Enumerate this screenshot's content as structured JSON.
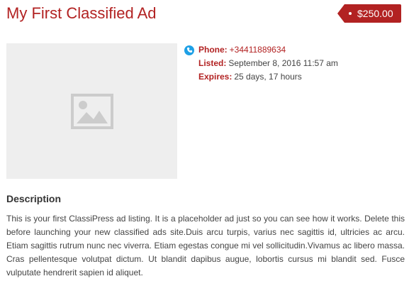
{
  "ad": {
    "title": "My First Classified Ad",
    "price": "$250.00",
    "image_icon": "image-placeholder-icon"
  },
  "meta": {
    "phone_label": "Phone:",
    "phone_value": "+34411889634",
    "listed_label": "Listed:",
    "listed_value": "September 8, 2016 11:57 am",
    "expires_label": "Expires:",
    "expires_value": "25 days, 17 hours"
  },
  "description": {
    "heading": "Description",
    "body": "This is your first ClassiPress ad listing. It is a placeholder ad just so you can see how it works. Delete this before launching your new classified ads site.Duis arcu turpis, varius nec sagittis id, ultricies ac arcu. Etiam sagittis rutrum nunc nec viverra. Etiam egestas congue mi vel sollicitudin.Vivamus ac libero massa. Cras pellentesque volutpat dictum. Ut blandit dapibus augue, lobortis cursus mi blandit sed. Fusce vulputate hendrerit sapien id aliquet."
  },
  "colors": {
    "accent": "#b22222",
    "phone_icon": "#1ea0e6",
    "image_bg": "#eeeeee"
  }
}
